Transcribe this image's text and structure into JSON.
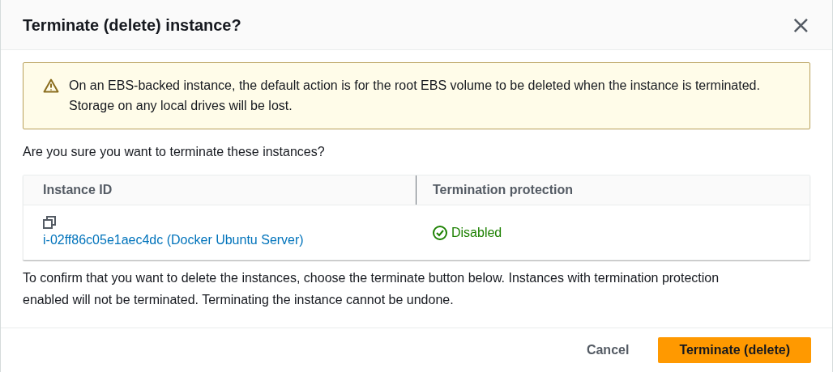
{
  "dialog": {
    "title": "Terminate (delete) instance?",
    "close": "×"
  },
  "alert": {
    "kind": "warning",
    "text": "On an EBS-backed instance, the default action is for the root EBS volume to be deleted when the instance is terminated. Storage on any local drives will be lost."
  },
  "question": "Are you sure you want to terminate these instances?",
  "table": {
    "columns": [
      "Instance ID",
      "Termination protection"
    ],
    "rows": [
      {
        "instance_id": "i-02ff86c05e1aec4dc (Docker Ubuntu Server)",
        "protection": {
          "text": "Disabled",
          "kind": "success"
        }
      }
    ]
  },
  "confirmation": "To confirm that you want to delete the instances, choose the terminate button below. Instances with termination protection enabled will not be terminated. Terminating the instance cannot be undone.",
  "buttons": [
    {
      "label": "Cancel",
      "kind": "link"
    },
    {
      "label": "Terminate (delete)",
      "kind": "primary"
    }
  ]
}
